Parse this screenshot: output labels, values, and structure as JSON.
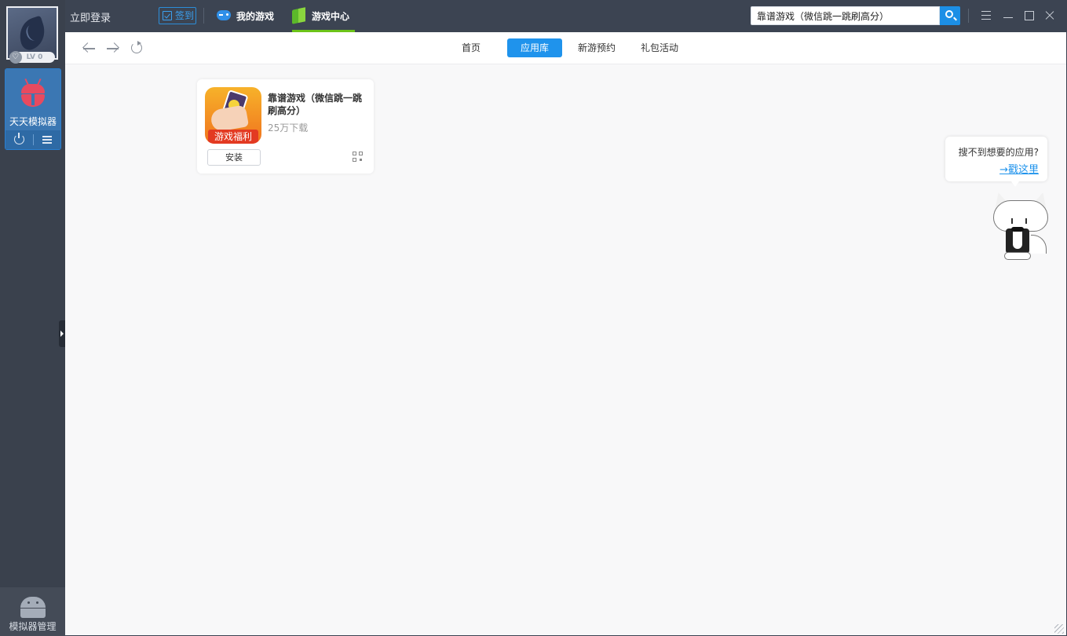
{
  "topbar": {
    "login_label": "立即登录",
    "signin_label": "签到",
    "tabs": [
      {
        "label": "我的游戏",
        "icon": "gamepad-icon"
      },
      {
        "label": "游戏中心",
        "icon": "cube-icon",
        "active": true
      }
    ],
    "search": {
      "value": "靠谱游戏（微信跳一跳刷高分）",
      "placeholder": ""
    }
  },
  "sidebar": {
    "level_label": "LV 0",
    "emulator_name": "天天模拟器",
    "manager_label": "模拟器管理"
  },
  "nav": {
    "tabs": [
      {
        "label": "首页"
      },
      {
        "label": "应用库",
        "active": true
      },
      {
        "label": "新游预约"
      },
      {
        "label": "礼包活动"
      }
    ]
  },
  "app_card": {
    "name": "靠谱游戏（微信跳一跳刷高分）",
    "downloads": "25万下载",
    "badge": "游戏福利",
    "install_label": "安装"
  },
  "tip": {
    "question": "搜不到想要的应用?",
    "link": "→戳这里"
  },
  "colors": {
    "accent": "#1f93ec",
    "active_tab_underline": "#6cc319",
    "topbar_bg": "#3c4452",
    "sidebar_bg": "#3a414d"
  }
}
